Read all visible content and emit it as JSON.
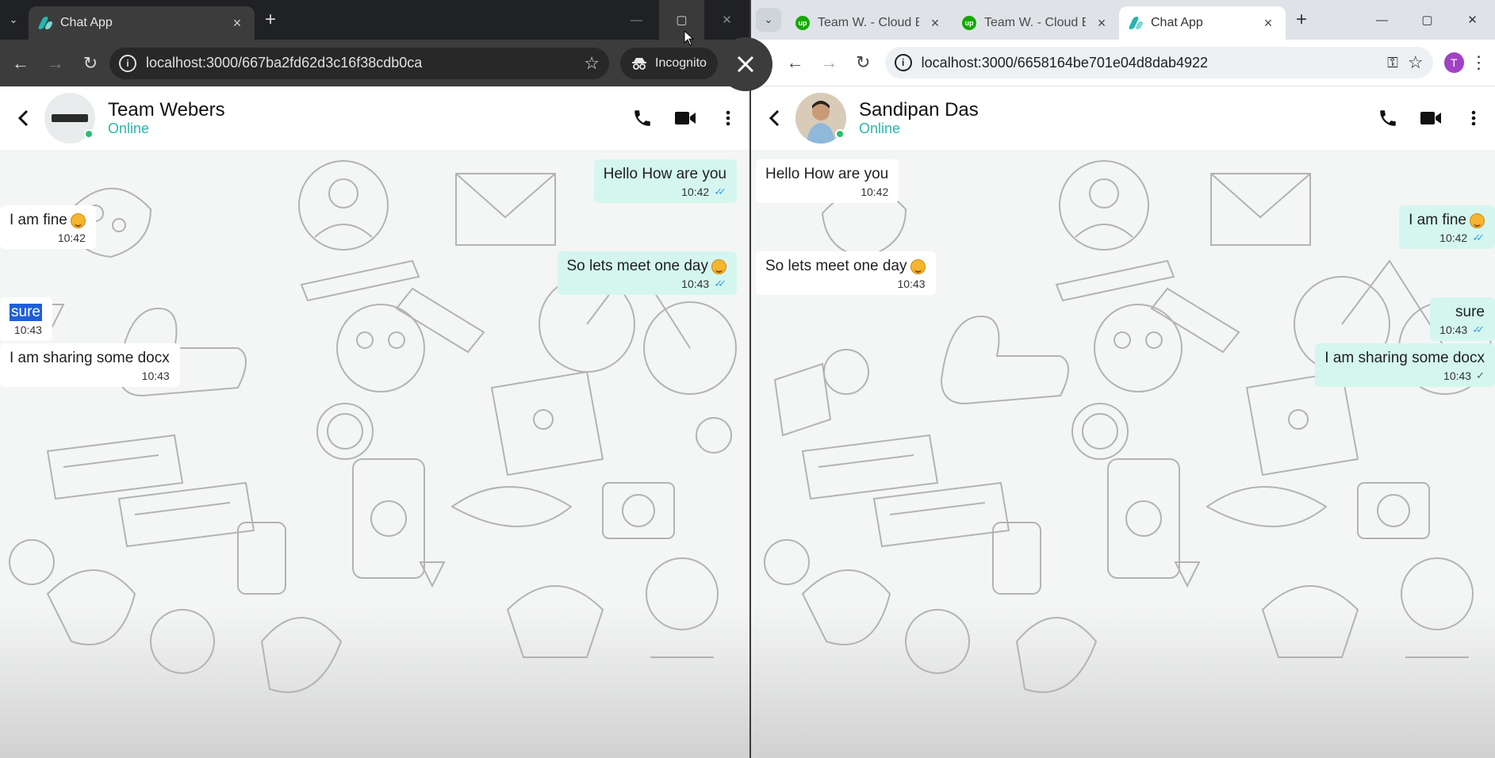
{
  "left": {
    "tabs": [
      {
        "title": "Chat App",
        "active": true
      }
    ],
    "address": "localhost:3000/667ba2fd62d3c16f38cdb0ca",
    "incognito_label": "Incognito",
    "contact": {
      "name": "Team Webers",
      "status": "Online"
    },
    "messages": [
      {
        "dir": "out",
        "text": "Hello How are you",
        "time": "10:42",
        "ticks": "read"
      },
      {
        "dir": "in",
        "text": "I am fine",
        "emoji": "smile",
        "time": "10:42"
      },
      {
        "dir": "out",
        "text": "So lets meet one day",
        "emoji": "halo",
        "time": "10:43",
        "ticks": "read"
      },
      {
        "dir": "in",
        "text": "sure",
        "time": "10:43",
        "selected": true
      },
      {
        "dir": "in",
        "text": "I am sharing some docx",
        "time": "10:43"
      }
    ]
  },
  "right": {
    "tabs": [
      {
        "title": "Team W. - Cloud B",
        "favicon": "up-icon"
      },
      {
        "title": "Team W. - Cloud B",
        "favicon": "up-icon"
      },
      {
        "title": "Chat App",
        "active": true
      }
    ],
    "address": "localhost:3000/6658164be701e04d8dab4922",
    "profile_initial": "T",
    "contact": {
      "name": "Sandipan Das",
      "status": "Online"
    },
    "messages": [
      {
        "dir": "in",
        "text": "Hello How are you",
        "time": "10:42"
      },
      {
        "dir": "out",
        "text": "I am fine",
        "emoji": "smile",
        "time": "10:42",
        "ticks": "read"
      },
      {
        "dir": "in",
        "text": "So lets meet one day",
        "emoji": "halo",
        "time": "10:43"
      },
      {
        "dir": "out",
        "text": "sure",
        "time": "10:43",
        "ticks": "read"
      },
      {
        "dir": "out",
        "text": "I am sharing some docx",
        "time": "10:43",
        "ticks": "sent"
      }
    ]
  },
  "colors": {
    "outgoing_bubble": "#d4f6ef",
    "incoming_bubble": "#ffffff",
    "online": "#2ab7a9",
    "read_ticks": "#3aa0e8"
  },
  "icons": [
    "back-icon",
    "phone-icon",
    "video-icon",
    "more-icon",
    "close-icon"
  ]
}
